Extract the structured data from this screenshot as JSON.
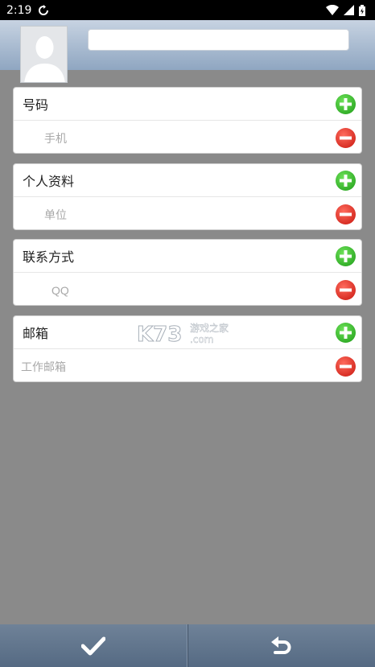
{
  "status_bar": {
    "time": "2:19",
    "icons": [
      "sync-icon",
      "wifi-icon",
      "signal-icon",
      "battery-icon"
    ]
  },
  "header": {
    "avatar_icon": "person-silhouette-icon",
    "name_input": {
      "value": "",
      "placeholder": ""
    }
  },
  "sections": [
    {
      "title": "号码",
      "field_placeholder": "手机"
    },
    {
      "title": "个人资料",
      "field_placeholder": "单位"
    },
    {
      "title": "联系方式",
      "field_placeholder": "QQ"
    },
    {
      "title": "邮箱",
      "field_placeholder": "工作邮箱"
    }
  ],
  "watermark": {
    "brand": "K73",
    "text": "游戏之家",
    "domain": ".com"
  },
  "bottom_bar": {
    "confirm_icon": "checkmark-icon",
    "back_icon": "undo-icon"
  },
  "colors": {
    "add": "#2fb52a",
    "remove": "#e1251b",
    "background": "#8a8a8a",
    "header": "#9fb3ca"
  }
}
